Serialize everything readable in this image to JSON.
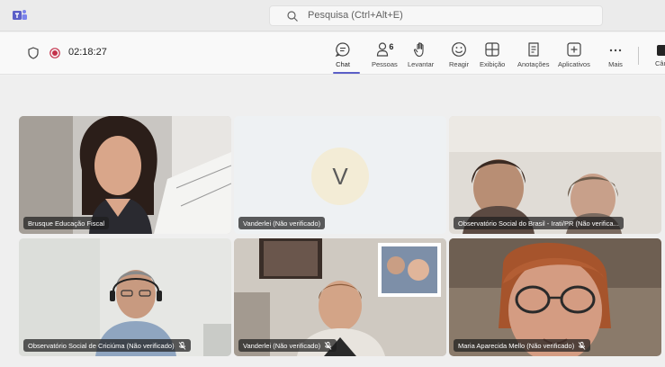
{
  "search": {
    "text": "Pesquisa (Ctrl+Alt+E)"
  },
  "meeting": {
    "timer": "02:18:27"
  },
  "toolbar": {
    "chat": "Chat",
    "people": "Pessoas",
    "people_count": "6",
    "raise": "Levantar",
    "react": "Reagir",
    "view": "Exibição",
    "notes": "Anotações",
    "apps": "Aplicativos",
    "more": "Mais",
    "camera": "Câmera"
  },
  "participants": [
    {
      "name": "Brusque Educação Fiscal",
      "muted": false
    },
    {
      "name": "Vanderlei (Não verificado)",
      "muted": false,
      "initial": "V"
    },
    {
      "name": "Observatório Social do Brasil - Irati/PR (Não verifica...",
      "muted": false
    },
    {
      "name": "Observatório Social de Criciúma (Não verificado)",
      "muted": true
    },
    {
      "name": "Vanderlei (Não verificado)",
      "muted": true
    },
    {
      "name": "Maria Aparecida Mello (Não verificado)",
      "muted": true
    }
  ],
  "colors": {
    "accent": "#5b5fc7",
    "recording": "#c4314b"
  }
}
